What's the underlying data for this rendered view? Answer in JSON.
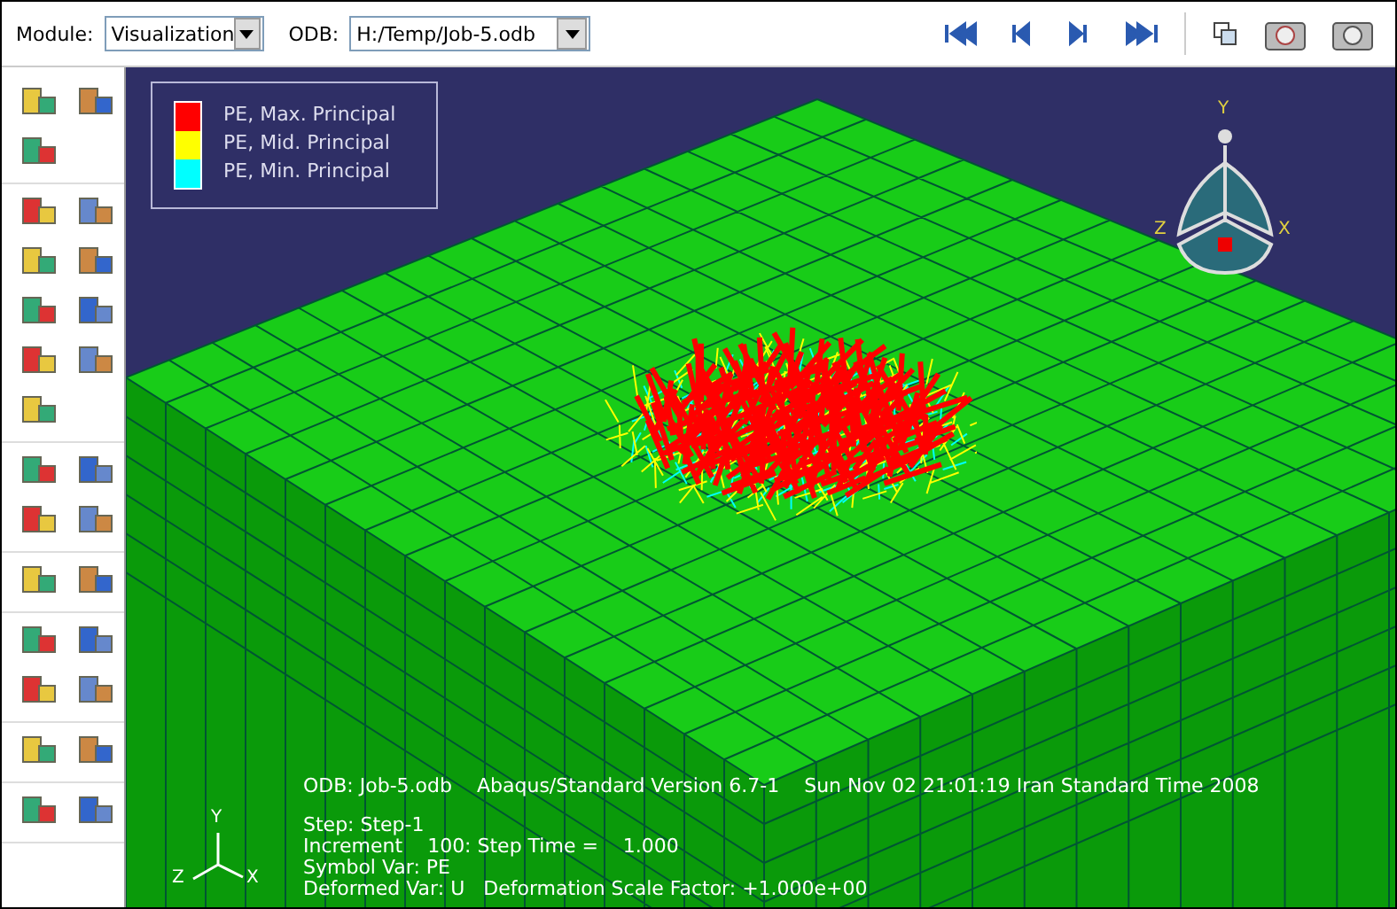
{
  "toolbar": {
    "module_label": "Module:",
    "module_value": "Visualization",
    "odb_label": "ODB:",
    "odb_value": "H:/Temp/Job-5.odb"
  },
  "legend": [
    {
      "label": "PE, Max. Principal",
      "color": "#ff0000"
    },
    {
      "label": "PE, Mid. Principal",
      "color": "#ffff00"
    },
    {
      "label": "PE, Min. Principal",
      "color": "#00ffff"
    }
  ],
  "triad": {
    "y": "Y",
    "z": "Z",
    "x": "X"
  },
  "small_triad": {
    "y": "Y",
    "z": "Z",
    "x": "X"
  },
  "info_header": [
    "ODB: Job-5.odb",
    "Abaqus/Standard Version 6.7-1",
    "Sun Nov 02 21:01:19 Iran Standard Time 2008"
  ],
  "info_lines": [
    "Step: Step-1",
    "Increment    100: Step Time =    1.000",
    "Symbol Var: PE",
    "Deformed Var: U   Deformation Scale Factor: +1.000e+00"
  ]
}
